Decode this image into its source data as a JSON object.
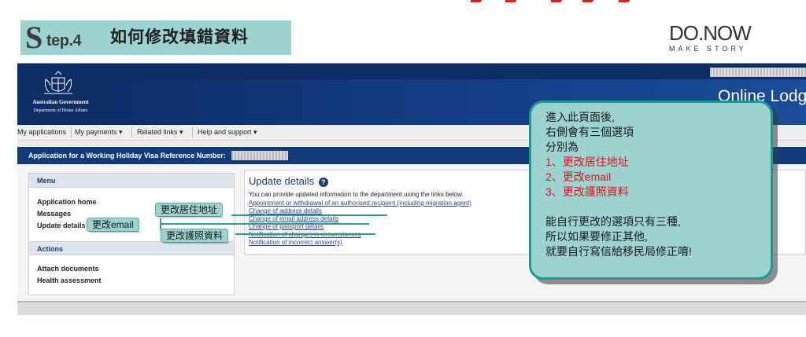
{
  "banner": {
    "step_letter": "S",
    "step_word": "tep.4",
    "title": "如何修改填錯資料",
    "brand_main": "DO.NOW",
    "brand_sub": "MAKE STORY",
    "accent_color": "#9cd2cf"
  },
  "gov_header": {
    "gov_name": "Australian Government",
    "dept_name": "Department of Home Affairs",
    "portal_title": "Online Lodgement",
    "background_color": "#0d2d66",
    "crest_icon": "coat-of-arms-icon"
  },
  "nav": {
    "items": [
      {
        "label": "My applications"
      },
      {
        "label": "My payments ▾"
      },
      {
        "label": "Related links ▾"
      },
      {
        "label": "Help and support ▾"
      }
    ]
  },
  "app_bar": {
    "label": "Application for a Working Holiday Visa Reference Number:",
    "color": "#123b7a"
  },
  "menu": {
    "heading": "Menu",
    "items": [
      {
        "label": "Application home"
      },
      {
        "label": "Messages"
      },
      {
        "label": "Update details"
      }
    ],
    "actions_heading": "Actions",
    "actions": [
      {
        "label": "Attach documents"
      },
      {
        "label": "Health assessment"
      }
    ]
  },
  "update_details": {
    "title": "Update details",
    "help_icon": "question-circle-icon",
    "description": "You can provide updated information to the department using the links below.",
    "links": [
      {
        "label": "Appointment or withdrawal of an authorised recipient (including migration agent)"
      },
      {
        "label": "Change of address details"
      },
      {
        "label": "Change of email address details"
      },
      {
        "label": "Change of passport details"
      },
      {
        "label": "Notification of changes in circumstances"
      },
      {
        "label": "Notification of incorrect answer(s)"
      }
    ]
  },
  "annotations": {
    "address_label": "更改居住地址",
    "email_label": "更改email",
    "passport_label": "更改護照資料",
    "line_color": "#2e9e95"
  },
  "bubble": {
    "lines": [
      {
        "text": "進入此頁面後,",
        "red": false
      },
      {
        "text": "右側會有三個選項",
        "red": false
      },
      {
        "text": "分別為",
        "red": false
      },
      {
        "text": "1、更改居住地址",
        "red": true
      },
      {
        "text": "2、更改email",
        "red": true
      },
      {
        "text": "3、更改護照資料",
        "red": true
      },
      {
        "text": "能自行更改的選項只有三種,",
        "red": false
      },
      {
        "text": "所以如果要修正其他,",
        "red": false
      },
      {
        "text": "就要自行寫信給移民局修正唷!",
        "red": false
      }
    ],
    "fill_color": "#9cd2cf",
    "border_color": "#1c9c8e",
    "highlight_color": "#e3121d"
  }
}
